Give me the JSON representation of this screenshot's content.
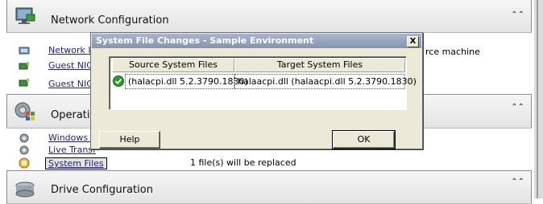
{
  "sections": {
    "network": {
      "title": "Network Configuration",
      "links": [
        "Network Id",
        "Guest NIC",
        "Guest NIC"
      ],
      "truncated_text": "rce machine"
    },
    "operating": {
      "title": "Operatin",
      "links": [
        "Windows S",
        "Live Transf",
        "System Files"
      ],
      "status_text": "1 file(s) will be replaced"
    },
    "drive": {
      "title": "Drive Configuration"
    }
  },
  "dialog": {
    "title": "System File Changes - Sample Environment",
    "close_label": "X",
    "columns": [
      "Source System Files",
      "Target System Files"
    ],
    "rows": [
      {
        "source": "(halacpi.dll 5.2.3790.1830)",
        "target": "halaacpi.dll (halaacpi.dll 5.2.3790.1830)"
      }
    ],
    "help_label": "Help",
    "ok_label": "OK"
  },
  "colors": {
    "dialog_bg": "#ece9d8",
    "title_bar": "#8f9ab3",
    "link": "#1a1aa6",
    "check_green": "#2e9b2e"
  }
}
